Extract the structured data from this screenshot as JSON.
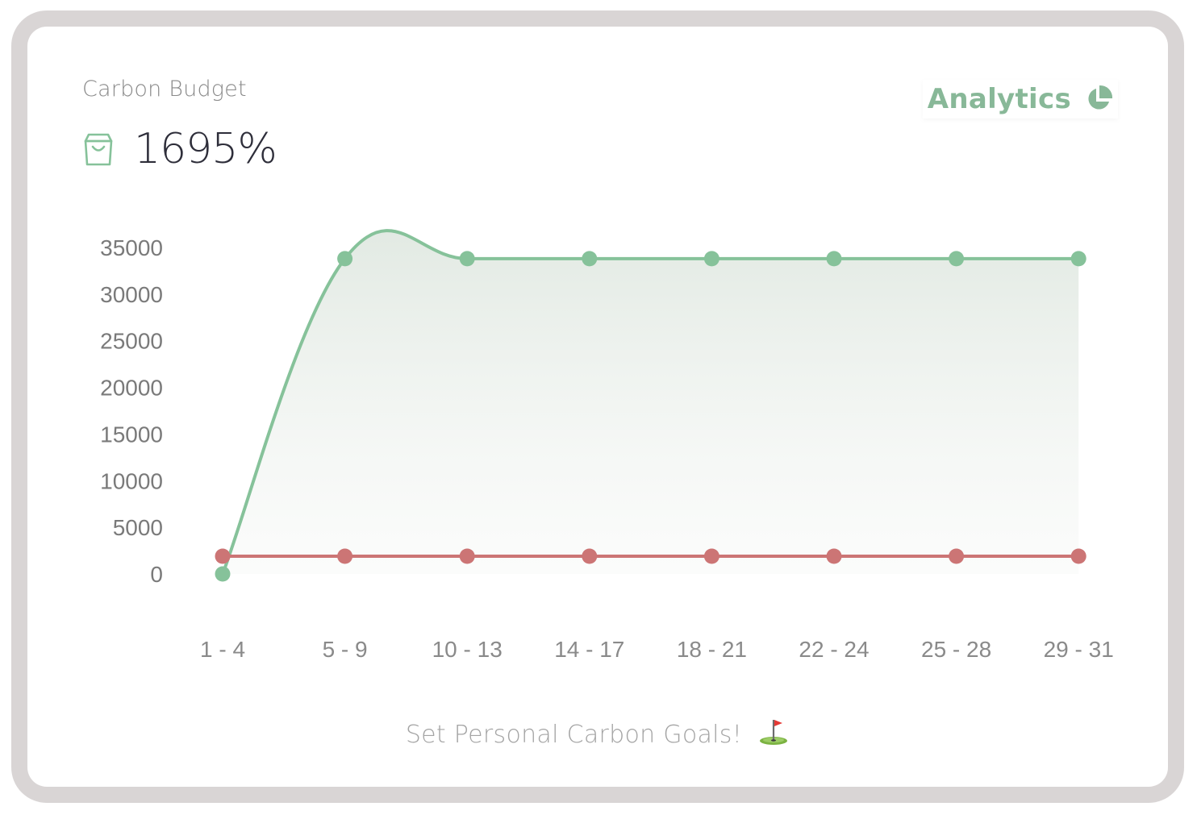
{
  "header": {
    "budget_label": "Carbon Budget",
    "budget_value": "1695%",
    "bag_icon": "shopping-bag-icon",
    "analytics_label": "Analytics",
    "analytics_icon": "pie-chart-icon"
  },
  "footer": {
    "cta_label": "Set Personal Carbon Goals!",
    "cta_icon": "golf-flag-icon"
  },
  "colors": {
    "accent_green": "#88b898",
    "series_green": "#86c29a",
    "series_red": "#cc7575",
    "frame": "#d9d5d5"
  },
  "chart_data": {
    "type": "line",
    "categories": [
      "1 - 4",
      "5 - 9",
      "10 - 13",
      "14 - 17",
      "18 - 21",
      "22 - 24",
      "25 - 28",
      "29 - 31"
    ],
    "series": [
      {
        "values": [
          0,
          33800,
          33800,
          33800,
          33800,
          33800,
          33800,
          33800
        ],
        "color": "#86c29a",
        "fill": "area-gradient",
        "smooth": true
      },
      {
        "values": [
          1900,
          1900,
          1900,
          1900,
          1900,
          1900,
          1900,
          1900
        ],
        "color": "#cc7575"
      }
    ],
    "yticks": [
      0,
      5000,
      10000,
      15000,
      20000,
      25000,
      30000,
      35000
    ],
    "ylim": [
      0,
      35000
    ],
    "grid": false,
    "legend": "none",
    "title": "",
    "xlabel": "",
    "ylabel": ""
  }
}
